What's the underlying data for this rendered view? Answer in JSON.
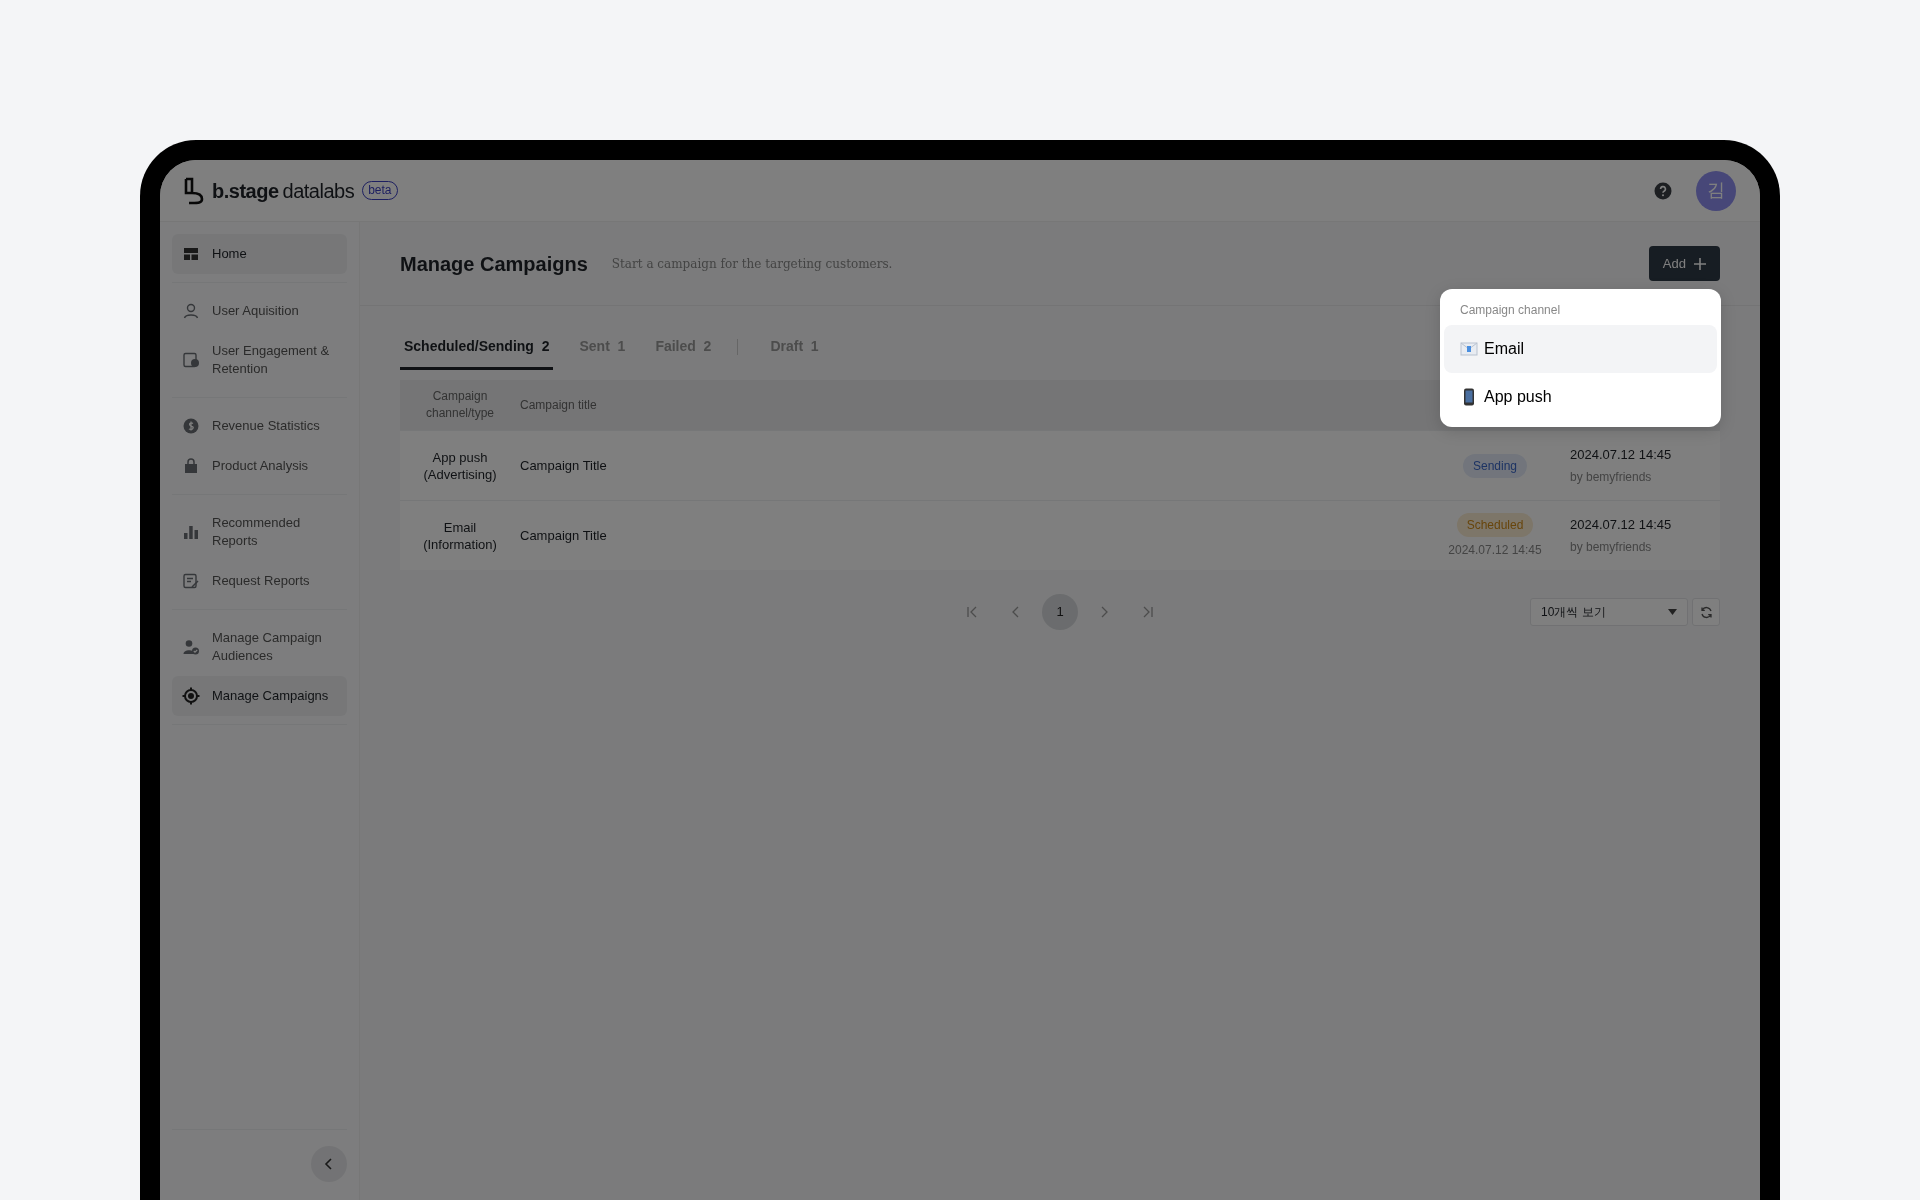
{
  "header": {
    "brand": "b.stage",
    "product": "datalabs",
    "badge": "beta",
    "avatar": "김"
  },
  "sidebar": {
    "groups": [
      {
        "items": [
          {
            "label": "Home",
            "selected": true
          }
        ]
      },
      {
        "items": [
          {
            "label": "User Aquisition",
            "selected": false
          },
          {
            "label": "User Engagement & Retention",
            "selected": false
          }
        ]
      },
      {
        "items": [
          {
            "label": "Revenue Statistics",
            "selected": false
          },
          {
            "label": "Product Analysis",
            "selected": false
          }
        ]
      },
      {
        "items": [
          {
            "label": "Recommended Reports",
            "selected": false
          },
          {
            "label": "Request Reports",
            "selected": false
          }
        ]
      },
      {
        "items": [
          {
            "label": "Manage Campaign Audiences",
            "selected": false
          },
          {
            "label": "Manage Campaigns",
            "selected": true
          }
        ]
      }
    ]
  },
  "page": {
    "title": "Manage Campaigns",
    "subtitle": "Start a campaign for the targeting customers.",
    "add_button": "Add"
  },
  "tabs": [
    {
      "label": "Scheduled/Sending",
      "count": "2",
      "selected": true,
      "divider_before": false
    },
    {
      "label": "Sent",
      "count": "1",
      "selected": false,
      "divider_before": false
    },
    {
      "label": "Failed",
      "count": "2",
      "selected": false,
      "divider_before": false
    },
    {
      "label": "Draft",
      "count": "1",
      "selected": false,
      "divider_before": true
    }
  ],
  "table": {
    "columns": [
      "Campaign channel/type",
      "Campaign title"
    ],
    "rows": [
      {
        "channel_type": "App push (Advertising)",
        "title": "Campaign Title",
        "status": {
          "kind": "sending",
          "label": "Sending"
        },
        "date": "2024.07.12 14:45",
        "author": "by bemyfriends"
      },
      {
        "channel_type": "Email (Information)",
        "title": "Campaign Title",
        "status": {
          "kind": "scheduled",
          "label": "Scheduled",
          "scheduled_at": "2024.07.12 14:45"
        },
        "date": "2024.07.12 14:45",
        "author": "by bemyfriends"
      }
    ]
  },
  "pagination": {
    "pages": [
      {
        "label": "1",
        "selected": true
      }
    ],
    "page_size": "10개씩 보기"
  },
  "dropdown": {
    "heading": "Campaign channel",
    "items": [
      {
        "kind": "email",
        "label": "Email",
        "selected": true
      },
      {
        "kind": "push",
        "label": "App push",
        "selected": false
      }
    ]
  }
}
